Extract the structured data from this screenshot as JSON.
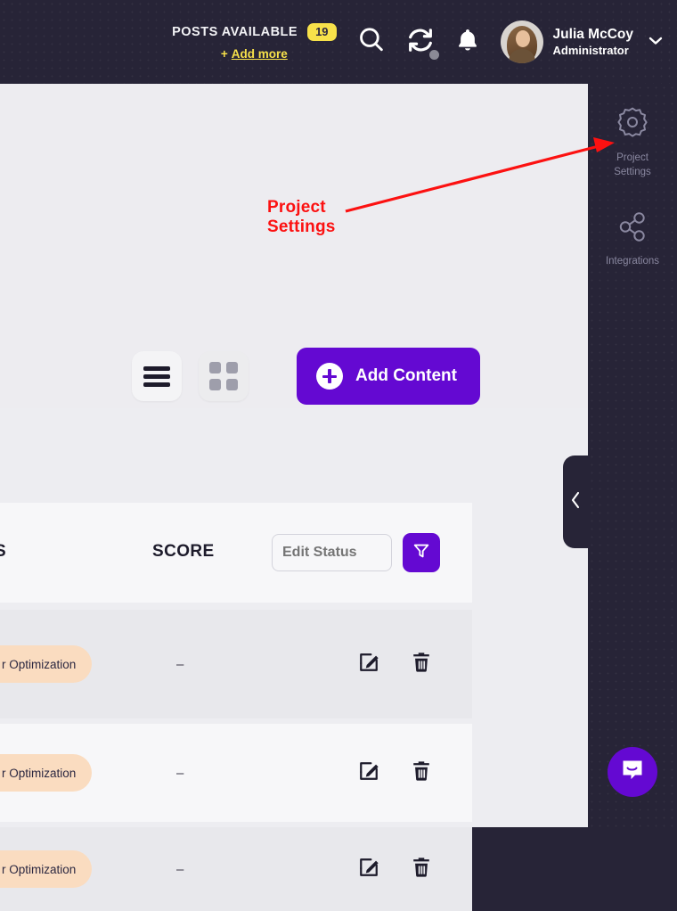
{
  "topbar": {
    "posts_label": "POSTS AVAILABLE",
    "posts_count": "19",
    "add_more_plus": "+",
    "add_more_label": "Add more",
    "icons": {
      "search": "search-icon",
      "sync": "sync-icon",
      "bell": "notification-bell-icon"
    },
    "user": {
      "name": "Julia McCoy",
      "role": "Administrator"
    }
  },
  "toolbar": {
    "list_view": "list-view-icon",
    "grid_view": "grid-view-icon",
    "add_content_label": "Add Content"
  },
  "table": {
    "headers": {
      "left_partial": "S",
      "score": "SCORE"
    },
    "edit_status_placeholder": "Edit Status",
    "filter_icon": "filter-funnel-icon",
    "rows": [
      {
        "status": "r Optimization",
        "score": "–",
        "edit": "edit-icon",
        "delete": "trash-icon"
      },
      {
        "status": "r Optimization",
        "score": "–",
        "edit": "edit-icon",
        "delete": "trash-icon"
      },
      {
        "status": "r Optimization",
        "score": "–",
        "edit": "edit-icon",
        "delete": "trash-icon"
      }
    ]
  },
  "rail": {
    "items": [
      {
        "icon": "gear-settings-icon",
        "label": "Project\nSettings",
        "line1": "Project",
        "line2": "Settings"
      },
      {
        "icon": "share-nodes-icon",
        "label": "Integrations",
        "line1": "Integrations",
        "line2": ""
      }
    ],
    "collapse_icon": "chevron-left-icon",
    "chat_icon": "chat-bubble-icon"
  },
  "annotation": {
    "line1": "Project",
    "line2": "Settings",
    "color": "#fc1111"
  },
  "colors": {
    "dark_bg": "#272437",
    "panel_bg": "#ededf1",
    "accent_purple": "#6409d2",
    "badge_yellow": "#f7e14a",
    "pill_peach": "#fadcc0",
    "annotation_red": "#fc1111"
  }
}
